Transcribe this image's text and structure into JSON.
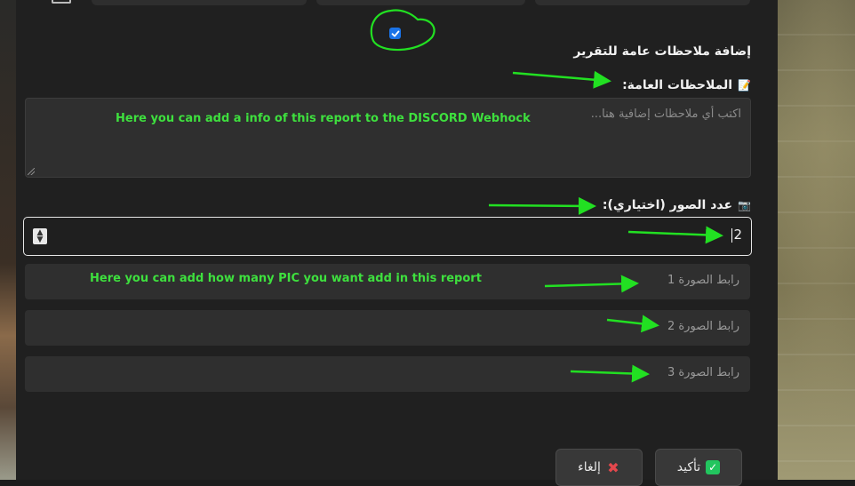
{
  "form": {
    "section_title": "إضافة ملاحظات عامة للتقرير",
    "notes_label": "الملاحظات العامة:",
    "notes_icon": "memo-icon",
    "notes_placeholder": "اكتب أي ملاحظات إضافية هنا...",
    "images_label": "عدد الصور (اختياري):",
    "images_icon": "camera-icon",
    "images_count_value": "2",
    "image_url_fields": [
      {
        "placeholder": "رابط الصورة 1"
      },
      {
        "placeholder": "رابط الصورة 2"
      },
      {
        "placeholder": "رابط الصورة 3"
      }
    ],
    "include_notes_checked": true
  },
  "buttons": {
    "confirm_label": "تأكيد",
    "cancel_label": "إلغاء"
  },
  "annotations": {
    "notes_hint": "Here you can add a info of this report to the DISCORD Webhock",
    "pics_hint": "Here you can add how many PIC you want add in this report"
  },
  "colors": {
    "annotation_green": "#3ee03e",
    "checkbox_blue": "#1a73e8",
    "confirm_green": "#22c55e",
    "cancel_red": "#e5484d"
  }
}
